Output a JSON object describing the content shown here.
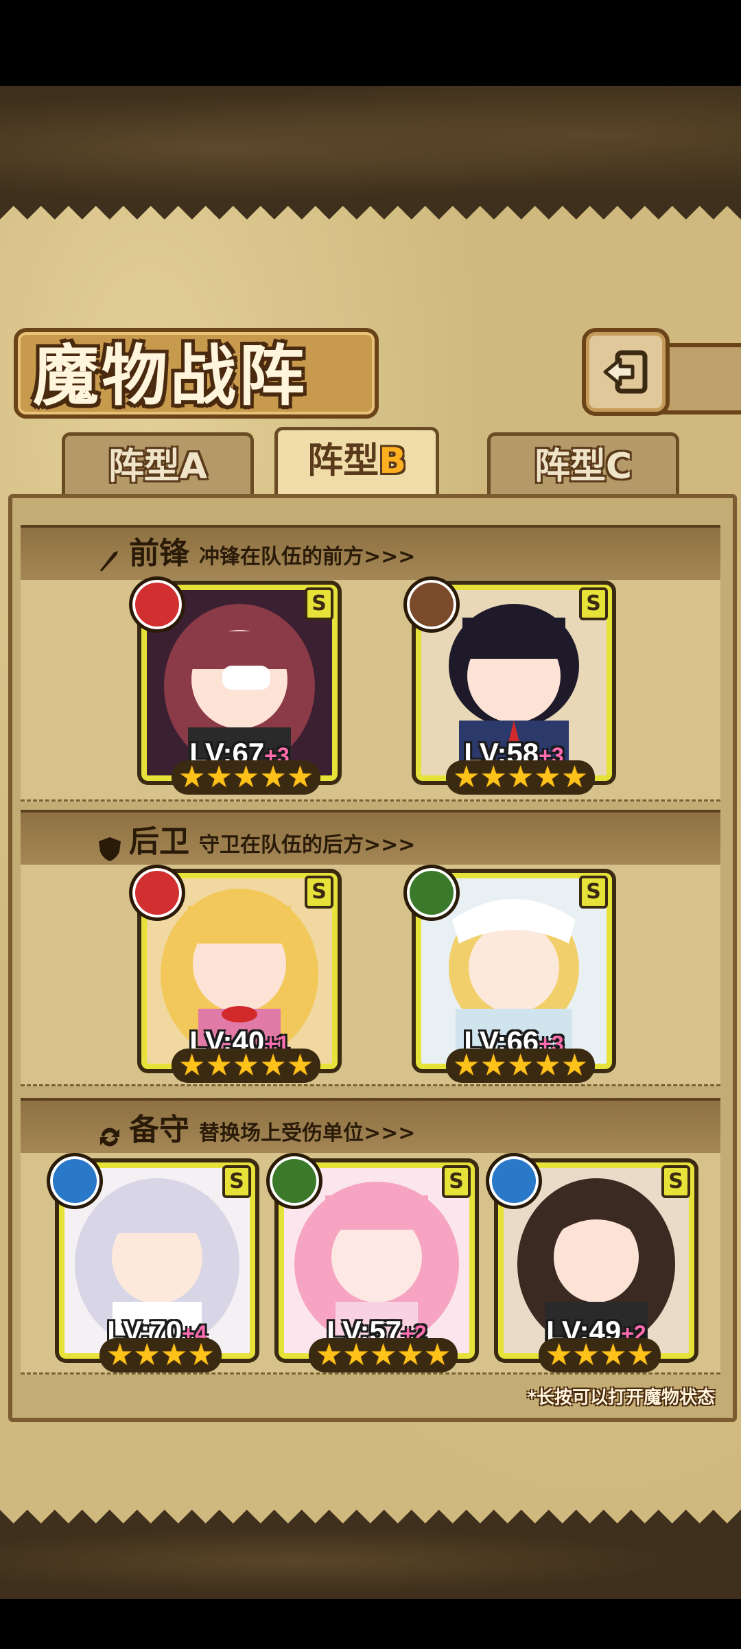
{
  "title": "魔物战阵",
  "tabs": [
    {
      "label": "阵型",
      "letter": "A",
      "active": false
    },
    {
      "label": "阵型",
      "letter": "B",
      "active": true
    },
    {
      "label": "阵型",
      "letter": "C",
      "active": false
    }
  ],
  "sections": {
    "front": {
      "name": "前锋",
      "desc": "冲锋在队伍的前方>>>",
      "icon": "sword-icon"
    },
    "rear": {
      "name": "后卫",
      "desc": "守卫在队伍的后方>>>",
      "icon": "shield-icon"
    },
    "reserve": {
      "name": "备守",
      "desc": "替换场上受伤单位>>>",
      "icon": "swap-icon"
    }
  },
  "units": [
    {
      "lv": "LV:67",
      "plus": "+3",
      "rank": "S",
      "element": "fire-icon",
      "stars": "★★★★★",
      "color": "#d23030"
    },
    {
      "lv": "LV:58",
      "plus": "+3",
      "rank": "S",
      "element": "earth-icon",
      "stars": "★★★★★",
      "color": "#7a4a2a"
    },
    {
      "lv": "LV:40",
      "plus": "+1",
      "rank": "S",
      "element": "fire-icon",
      "stars": "★★★★★",
      "color": "#d23030"
    },
    {
      "lv": "LV:66",
      "plus": "+3",
      "rank": "S",
      "element": "leaf-icon",
      "stars": "★★★★★",
      "color": "#3a7a2a"
    },
    {
      "lv": "LV:70",
      "plus": "+4",
      "rank": "S",
      "element": "water-icon",
      "stars": "★★★★",
      "color": "#2a78c8"
    },
    {
      "lv": "LV:57",
      "plus": "+2",
      "rank": "S",
      "element": "leaf-icon",
      "stars": "★★★★★",
      "color": "#3a7a2a"
    },
    {
      "lv": "LV:49",
      "plus": "+2",
      "rank": "S",
      "element": "water-icon",
      "stars": "★★★★",
      "color": "#2a78c8"
    }
  ],
  "footnote": "*长按可以打开魔物状态"
}
